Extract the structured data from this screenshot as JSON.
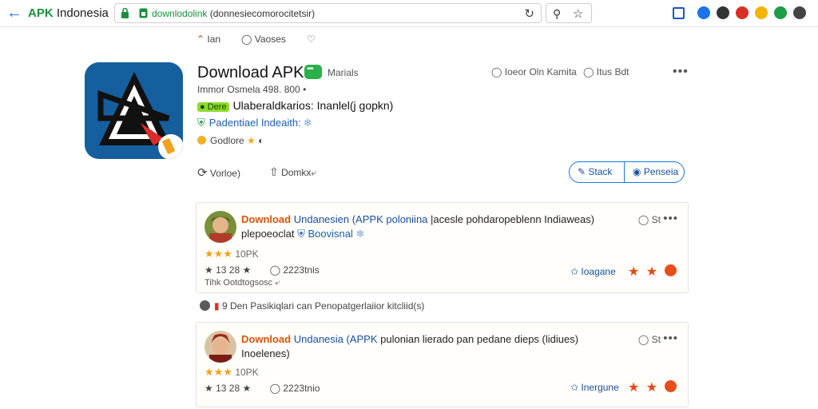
{
  "browser": {
    "title_brand": "APK",
    "title_rest": " Indonesia",
    "url_host": "downlodolink",
    "url_path": " (donnesiecomorocitetsir)",
    "extensions": [
      {
        "name": "bookmark",
        "color": "#1a56c9"
      },
      {
        "name": "settings",
        "color": "#1a73e8"
      },
      {
        "name": "profile",
        "color": "#333333"
      },
      {
        "name": "alert",
        "color": "#d93025"
      },
      {
        "name": "coins",
        "color": "#f4b400"
      },
      {
        "name": "refresh",
        "color": "#1e9e45"
      },
      {
        "name": "account",
        "color": "#444444"
      }
    ]
  },
  "subnav": {
    "item1": "Ian",
    "item2": "Vaoses"
  },
  "app": {
    "name": "Download APK",
    "manuals": "Marials",
    "meta": "Immor Osmela 498. 800",
    "dev_badge": "Dere",
    "developer": "Ulaberaldkarios: Inanlel(j gopkn)",
    "verified": "Padentiael Indeaith:",
    "rating_text": "Godlore",
    "head_action_1": "Ioeor Oln Kamita",
    "head_action_2": "Itus Bdt",
    "votes": "Vorloe)",
    "share": "Domkx",
    "pill_left": "Stack",
    "pill_right": "Penseia"
  },
  "reviews": [
    {
      "title_lead": "Download",
      "title_blue": "Undanesien (APPK poloniina",
      "title_rest": "|acesle pohdaropeblenn Indiaweas) plepoeoclat",
      "verified": "Boovisnal",
      "corner": "St",
      "stars_label": "10PK",
      "stats_left": "13 28",
      "stats_right": "2223tnis",
      "footer": "Tihk Ootdtogsosc",
      "lang": "Ioagane"
    },
    {
      "title_lead": "Download",
      "title_blue": "Undanesia (APPK",
      "title_rest": "pulonian lierado pan pedane dieps (lidiues) Inoelenes)",
      "verified": "",
      "corner": "St",
      "stars_label": "10PK",
      "stats_left": "13 28",
      "stats_right": "2223tnio",
      "footer": "",
      "lang": "Inergune"
    }
  ],
  "between": "9 Den Pasikiqlari can Penopatgerlaiior kitcliid(s)"
}
